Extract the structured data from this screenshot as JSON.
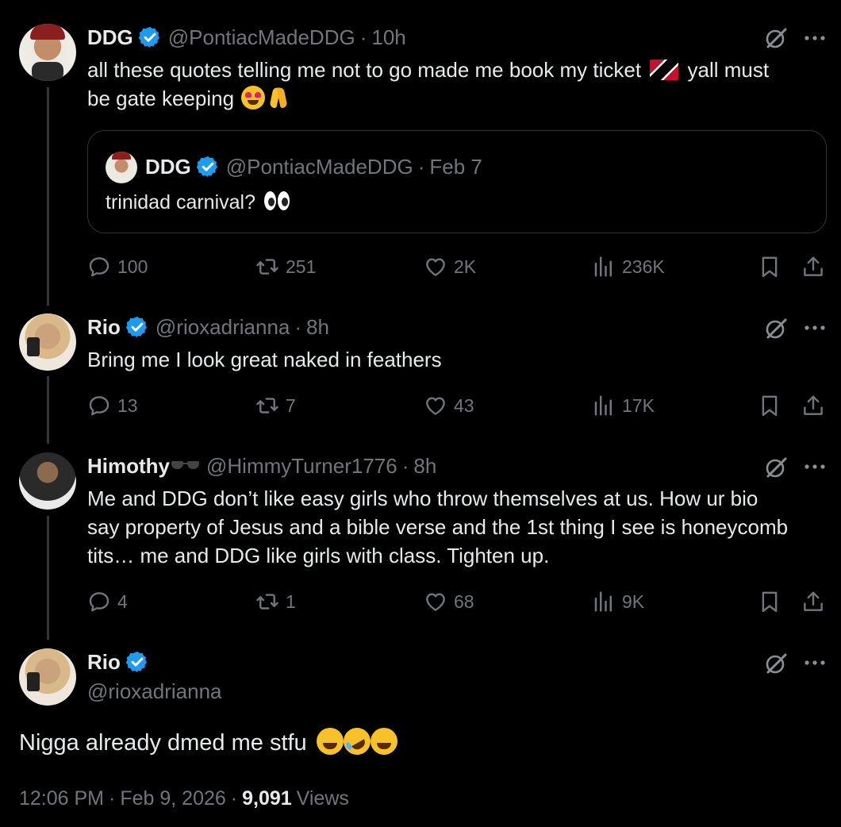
{
  "tweets": [
    {
      "name": "DDG",
      "handle": "@PontiacMadeDDG",
      "time": "10h",
      "text_line1": "all these quotes telling me not to go made me book my ticket",
      "text_line1b": "yall must",
      "text_line2": "be gate keeping",
      "quote": {
        "name": "DDG",
        "handle": "@PontiacMadeDDG",
        "date": "Feb 7",
        "text": "trinidad carnival?"
      },
      "replies": "100",
      "reposts": "251",
      "likes": "2K",
      "views": "236K"
    },
    {
      "name": "Rio",
      "handle": "@rioxadrianna",
      "time": "8h",
      "text": "Bring me I look great naked in feathers",
      "replies": "13",
      "reposts": "7",
      "likes": "43",
      "views": "17K"
    },
    {
      "name": "Himothy",
      "handle": "@HimmyTurner1776",
      "time": "8h",
      "text_lines": [
        "Me and DDG don’t like easy girls who throw themselves at us. How ur bio",
        "say property of Jesus and a bible verse and the 1st thing I see is honeycomb",
        "tits… me and DDG like girls with class. Tighten up."
      ],
      "replies": "4",
      "reposts": "1",
      "likes": "68",
      "views": "9K"
    }
  ],
  "main": {
    "name": "Rio",
    "handle": "@rioxadrianna",
    "text": "Nigga already dmed me stfu",
    "time": "12:06 PM",
    "date": "Feb 9, 2026",
    "views_count": "9,091",
    "views_label": "Views"
  },
  "colors": {
    "background": "#000000",
    "text": "#e7e9ea",
    "muted": "#71767b",
    "verified": "#1d9bf0",
    "border": "#2f3336"
  },
  "icons": [
    "verified-badge-icon",
    "grok-icon",
    "more-icon",
    "reply-icon",
    "repost-icon",
    "like-icon",
    "views-icon",
    "bookmark-icon",
    "share-icon"
  ]
}
